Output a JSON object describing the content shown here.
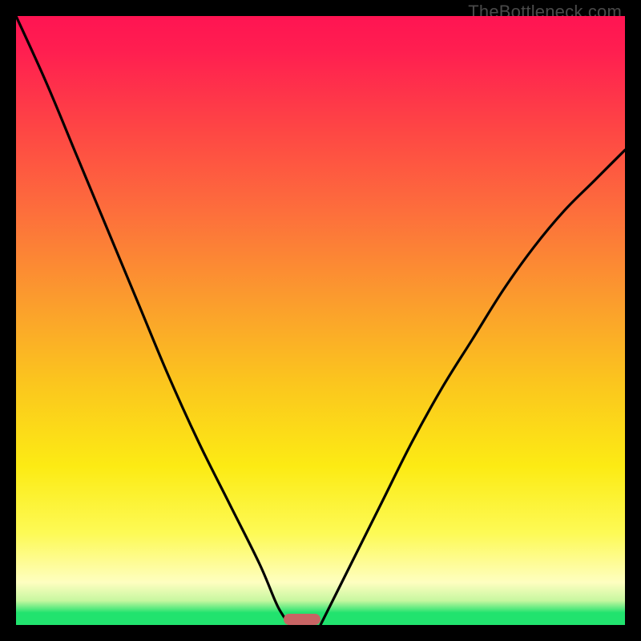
{
  "watermark": {
    "text": "TheBottleneck.com"
  },
  "chart_data": {
    "type": "line",
    "title": "",
    "xlabel": "",
    "ylabel": "",
    "xlim": [
      0,
      100
    ],
    "ylim": [
      0,
      100
    ],
    "grid": false,
    "legend": false,
    "series": [
      {
        "name": "left-curve",
        "x": [
          0,
          5,
          10,
          15,
          20,
          25,
          30,
          35,
          40,
          43,
          45
        ],
        "y": [
          100,
          89,
          77,
          65,
          53,
          41,
          30,
          20,
          10,
          3,
          0
        ]
      },
      {
        "name": "right-curve",
        "x": [
          50,
          52,
          55,
          60,
          65,
          70,
          75,
          80,
          85,
          90,
          95,
          100
        ],
        "y": [
          0,
          4,
          10,
          20,
          30,
          39,
          47,
          55,
          62,
          68,
          73,
          78
        ]
      }
    ],
    "marker": {
      "name": "bottleneck-marker",
      "x_center": 47,
      "y": 0,
      "width_pct": 6,
      "color": "#c86464"
    },
    "gradient_stops": [
      {
        "pos": 0.0,
        "color": "#ff1452"
      },
      {
        "pos": 0.32,
        "color": "#fd6e3c"
      },
      {
        "pos": 0.6,
        "color": "#fbc51e"
      },
      {
        "pos": 0.85,
        "color": "#fdfa56"
      },
      {
        "pos": 0.98,
        "color": "#21e36e"
      }
    ]
  }
}
